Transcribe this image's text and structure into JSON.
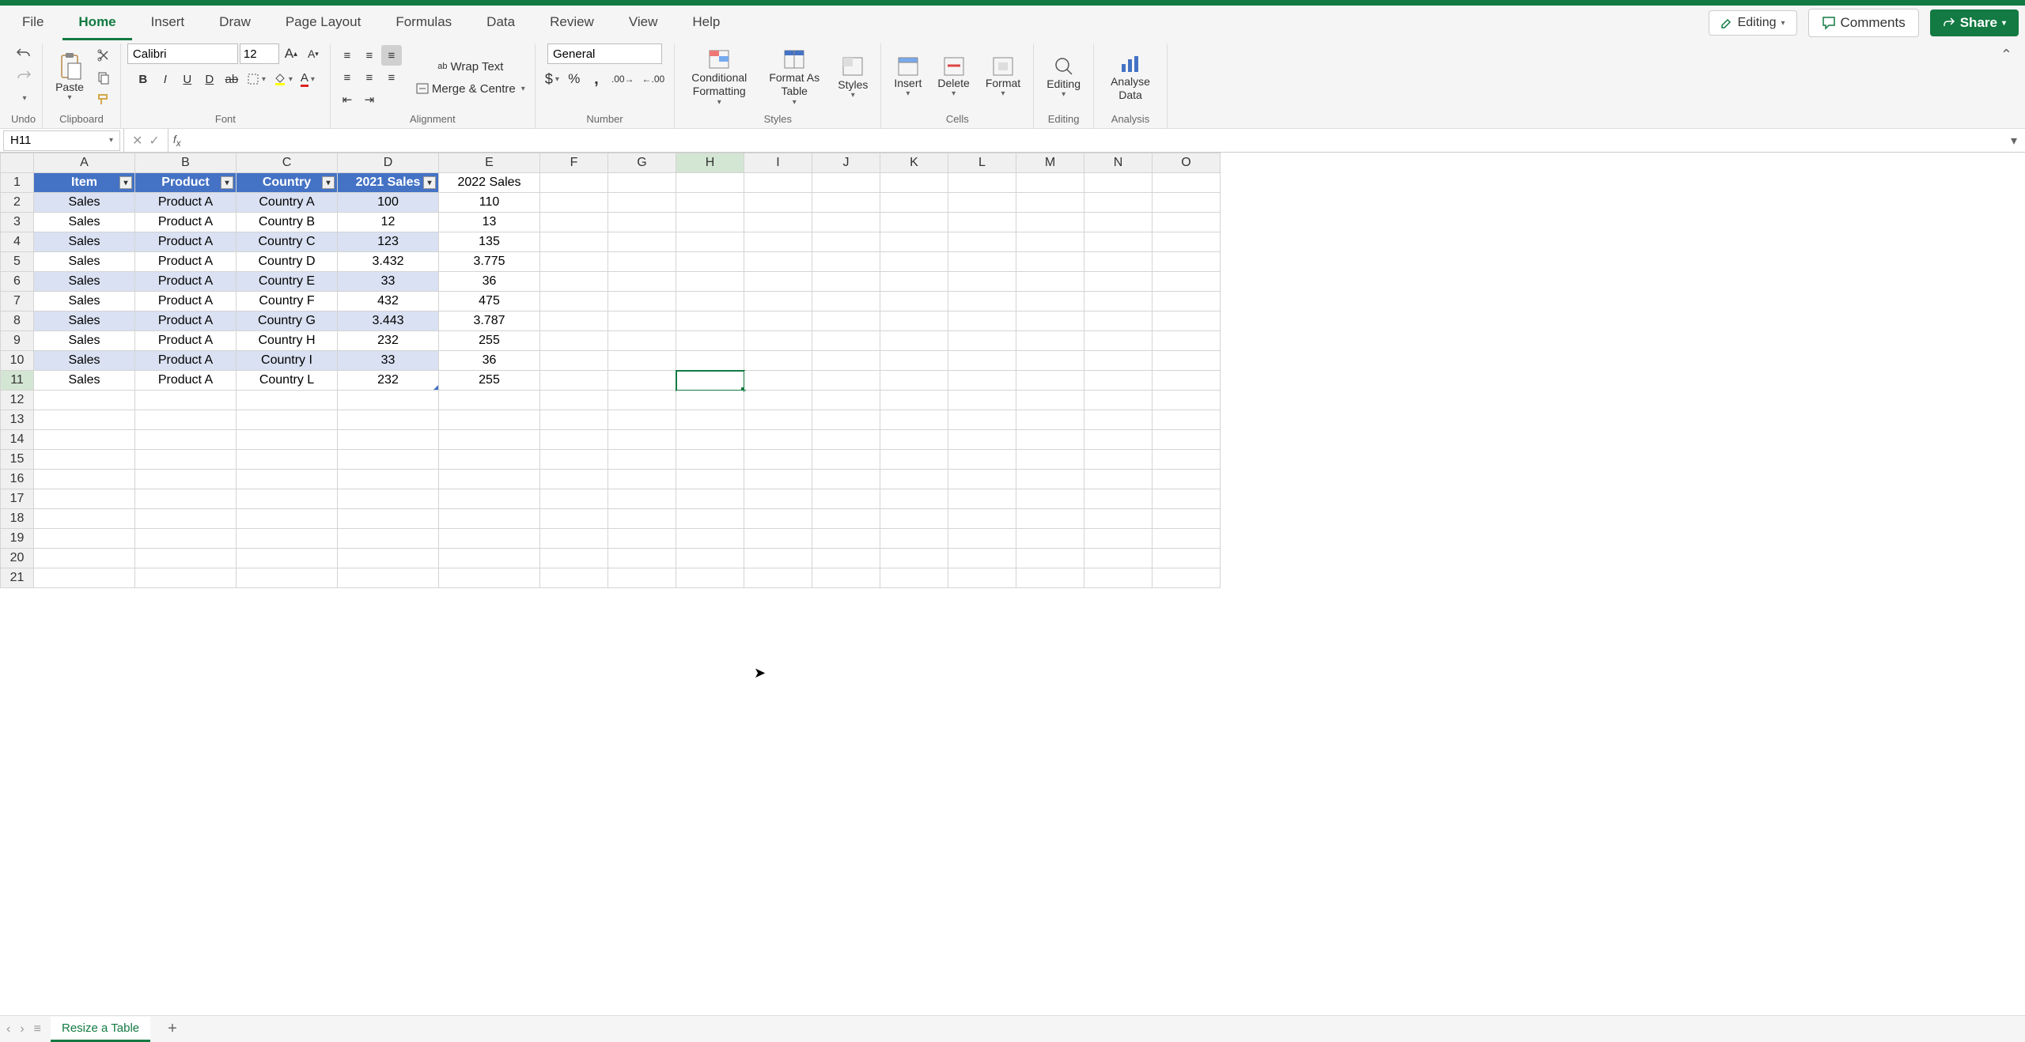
{
  "tabs": [
    "File",
    "Home",
    "Insert",
    "Draw",
    "Page Layout",
    "Formulas",
    "Data",
    "Review",
    "View",
    "Help"
  ],
  "active_tab": "Home",
  "mode_button": "Editing",
  "comments_label": "Comments",
  "share_label": "Share",
  "ribbon": {
    "undo_label": "Undo",
    "clipboard_label": "Clipboard",
    "paste_label": "Paste",
    "font_label": "Font",
    "font_name": "Calibri",
    "font_size": "12",
    "alignment_label": "Alignment",
    "wrap_label": "Wrap Text",
    "merge_label": "Merge & Centre",
    "number_label": "Number",
    "number_format": "General",
    "styles_label": "Styles",
    "cond_fmt": "Conditional Formatting",
    "fmt_table": "Format As Table",
    "styles_btn": "Styles",
    "cells_label": "Cells",
    "insert_btn": "Insert",
    "delete_btn": "Delete",
    "format_btn": "Format",
    "editing_label": "Editing",
    "editing_btn": "Editing",
    "analysis_label": "Analysis",
    "analyse_btn": "Analyse Data"
  },
  "name_box": "H11",
  "formula_value": "",
  "columns": [
    "A",
    "B",
    "C",
    "D",
    "E",
    "F",
    "G",
    "H",
    "I",
    "J",
    "K",
    "L",
    "M",
    "N",
    "O"
  ],
  "col_widths": {
    "A": 128,
    "B": 128,
    "C": 128,
    "D": 128,
    "E": 128,
    "F": 86,
    "G": 86,
    "H": 86,
    "I": 86,
    "J": 86,
    "K": 86,
    "L": 86,
    "M": 86,
    "N": 86,
    "O": 86
  },
  "row_count": 21,
  "selected_cell": {
    "col": "H",
    "row": 11
  },
  "table": {
    "headers": [
      "Item",
      "Product",
      "Country",
      "2021 Sales"
    ],
    "extra_header": "2022 Sales",
    "rows": [
      {
        "item": "Sales",
        "product": "Product A",
        "country": "Country A",
        "s2021": "100",
        "s2022": "110"
      },
      {
        "item": "Sales",
        "product": "Product A",
        "country": "Country B",
        "s2021": "12",
        "s2022": "13"
      },
      {
        "item": "Sales",
        "product": "Product A",
        "country": "Country C",
        "s2021": "123",
        "s2022": "135"
      },
      {
        "item": "Sales",
        "product": "Product A",
        "country": "Country D",
        "s2021": "3.432",
        "s2022": "3.775"
      },
      {
        "item": "Sales",
        "product": "Product A",
        "country": "Country E",
        "s2021": "33",
        "s2022": "36"
      },
      {
        "item": "Sales",
        "product": "Product A",
        "country": "Country F",
        "s2021": "432",
        "s2022": "475"
      },
      {
        "item": "Sales",
        "product": "Product A",
        "country": "Country G",
        "s2021": "3.443",
        "s2022": "3.787"
      },
      {
        "item": "Sales",
        "product": "Product A",
        "country": "Country H",
        "s2021": "232",
        "s2022": "255"
      },
      {
        "item": "Sales",
        "product": "Product A",
        "country": "Country I",
        "s2021": "33",
        "s2022": "36"
      },
      {
        "item": "Sales",
        "product": "Product A",
        "country": "Country L",
        "s2021": "232",
        "s2022": "255"
      }
    ]
  },
  "sheet_name": "Resize a Table"
}
